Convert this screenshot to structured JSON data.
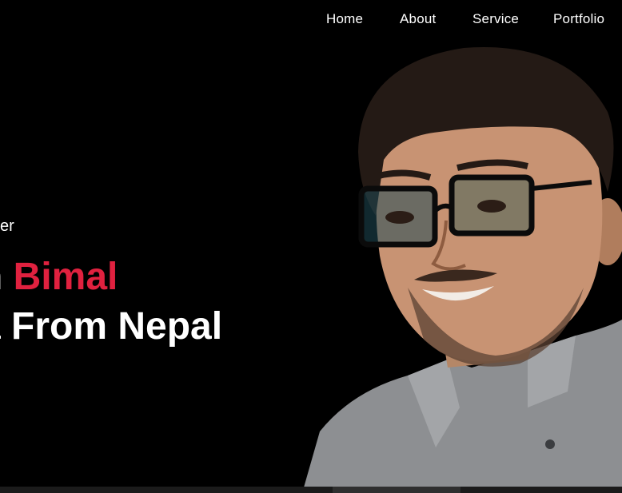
{
  "nav": {
    "items": [
      {
        "label": "Home"
      },
      {
        "label": "About"
      },
      {
        "label": "Service"
      },
      {
        "label": "Portfolio"
      }
    ]
  },
  "hero": {
    "subtitle": "er",
    "headline_line1_prefix": "n ",
    "headline_name": "Bimal",
    "headline_line2": "a From Nepal",
    "accent_color": "#e0213f"
  },
  "portrait": {
    "icon": "person-photo",
    "description_alt": "Portrait photo"
  }
}
